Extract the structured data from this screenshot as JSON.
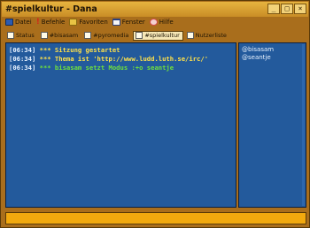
{
  "window": {
    "title": "#spielkultur - Dana"
  },
  "titlebar_buttons": [
    "_",
    "□",
    "×"
  ],
  "menu": [
    {
      "label": "Datei",
      "icon": "disk-icon",
      "color": "#2b5bb0"
    },
    {
      "label": "Befehle",
      "icon": "exclamation-icon",
      "color": "#d12a1c"
    },
    {
      "label": "Favoriten",
      "icon": "folder-icon",
      "color": "#e9c444"
    },
    {
      "label": "Fenster",
      "icon": "window-icon",
      "color": "#f5f5f5"
    },
    {
      "label": "Hilfe",
      "icon": "help-no-icon",
      "color": "#d64a4a"
    }
  ],
  "switchbar": [
    {
      "label": "Status",
      "active": false
    },
    {
      "label": "#bisasam",
      "active": false
    },
    {
      "label": "#pyromedia",
      "active": false
    },
    {
      "label": "#spielkultur",
      "active": true
    },
    {
      "label": "Nutzerliste",
      "active": false
    }
  ],
  "messages": [
    {
      "time": "[06:34]",
      "text": "*** Sitzung gestartet",
      "color": "#ffe14a"
    },
    {
      "time": "[06:34]",
      "text": "*** Thema ist 'http://www.ludd.luth.se/irc/'",
      "color": "#ffe14a"
    },
    {
      "time": "[06:34]",
      "text": "*** bisasam setzt Modus :+o seantje",
      "color": "#6fe03c"
    }
  ],
  "nicklist": [
    "@bisasam",
    "@seantje"
  ],
  "colors": {
    "frame": "#a96e1c",
    "chat_bg": "#235a9c",
    "input_bg": "#f2a90e"
  }
}
